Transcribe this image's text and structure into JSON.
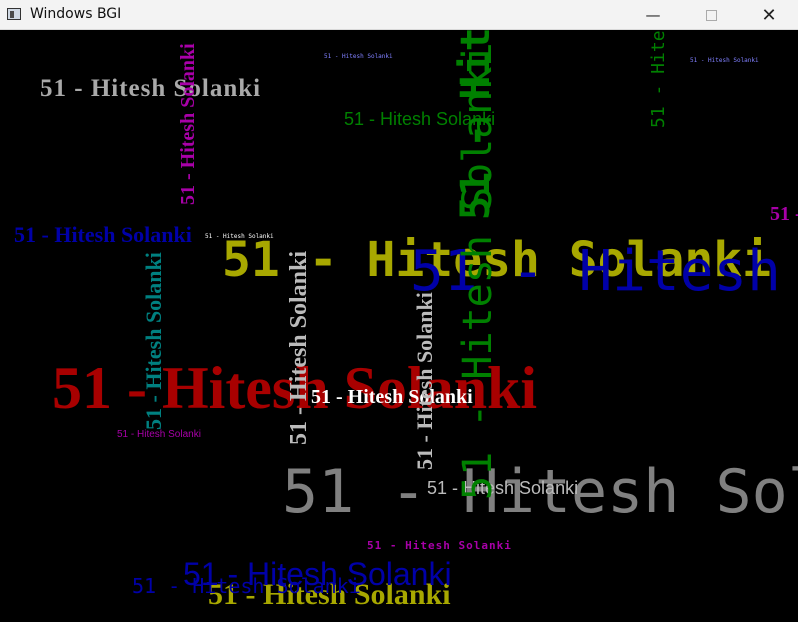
{
  "window": {
    "title": "Windows BGI",
    "minimize_glyph": "—",
    "close_glyph": "✕"
  },
  "canvas": {
    "texts": [
      {
        "text": "51 - Hitesh Solanki",
        "color": "#a9a9a9"
      },
      {
        "text": "51 - Hitesh Solanki",
        "color": "#008000"
      },
      {
        "text": "51 - Hitesh Solanki",
        "color": "#0000a8"
      },
      {
        "text": "51 - Hitesh Solanki",
        "color": "#a8a800"
      },
      {
        "text": "51 - Hitesh Solanki",
        "color": "#a80000"
      },
      {
        "text": "51 - Hitesh Solanki",
        "color": "#ffffff"
      },
      {
        "text": "51 - Hitesh Solanki",
        "color": "#808080"
      },
      {
        "text": "51 - Hitesh Solanki",
        "color": "#ffffff"
      },
      {
        "text": "51 - Hitesh Solanki",
        "color": "#a800a8"
      },
      {
        "text": "51 - Hitesh Solanki",
        "color": "#a800a8"
      },
      {
        "text": "51 - Hitesh Solanki",
        "color": "#0000a8"
      },
      {
        "text": "51 - Hitesh Solanki",
        "color": "#a8a800"
      },
      {
        "text": "51 - Hitesh Solanki",
        "color": "#008080"
      },
      {
        "text": "51 - Hitesh Solanki",
        "color": "#a800a8"
      },
      {
        "text": "51 - Hitesh Solanki",
        "color": "#bbbbbb"
      },
      {
        "text": "51 - Hitesh Solanki",
        "color": "#bbbbbb"
      },
      {
        "text": "51 - Hitesh Solanki",
        "color": "#008000"
      },
      {
        "text": "51 - Hitesh Solanki",
        "color": "#008000"
      },
      {
        "text": "51 - Hitesh Solanki",
        "color": "#a800a8"
      },
      {
        "text": "51 - Hitesh Solanki",
        "color": "#0000a8"
      },
      {
        "text": "51 - Hitesh Solanki",
        "color": "#8080ff"
      }
    ]
  }
}
